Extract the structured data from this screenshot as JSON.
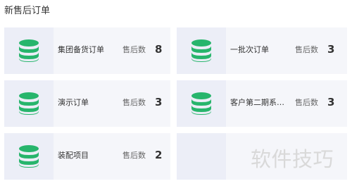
{
  "section_title": "新售后订单",
  "colors": {
    "icon_green": "#27b56c",
    "card_bg": "#f5f6fa",
    "icon_bg": "#eceef7"
  },
  "cards": [
    {
      "name": "集团备货订单",
      "label": "售后数",
      "count": "8",
      "icon": "database-icon"
    },
    {
      "name": "一批次订单",
      "label": "售后数",
      "count": "3",
      "icon": "database-icon"
    },
    {
      "name": "演示订单",
      "label": "售后数",
      "count": "3",
      "icon": "database-icon"
    },
    {
      "name": "客户第二期系…",
      "label": "售后数",
      "count": "3",
      "icon": "database-icon"
    },
    {
      "name": "装配项目",
      "label": "售后数",
      "count": "2",
      "icon": "database-icon"
    }
  ],
  "watermark": "软件技巧"
}
